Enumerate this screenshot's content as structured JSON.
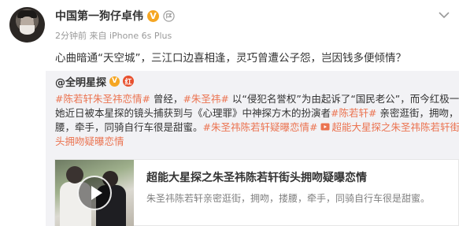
{
  "post": {
    "author": "中国第一狗仔卓伟",
    "verified_badge": "V",
    "meta": "2分钟前 来自 iPhone 6s Plus",
    "text": "心曲暗通“天空城”，三江口边喜相逢，灵巧曾遭公子怨，岂因钱多便倾情？"
  },
  "repost": {
    "author": "@全明星探",
    "verified_badge": "V",
    "hot_badge": "红",
    "line1": {
      "tag1": "#陈若轩朱圣祎恋情#",
      "t1": " 曾经，",
      "tag2": "#朱圣祎#",
      "t2": " 以“侵犯名誉权”为由起诉了“国民老公”，而今红极一时的"
    },
    "line2": {
      "t1": "她近日被本星探的镜头捕获到与《心理罪》中神探方木的扮演者",
      "tag": "#陈若轩#",
      "t2": " 亲密逛街，拥吻，搂"
    },
    "line3": {
      "t1": "腰，牵手，同骑自行车很是甜蜜。",
      "tag": "#朱圣祎陈若轩疑曝恋情#",
      "link": "超能大星探之朱圣祎陈若轩街"
    },
    "line4": {
      "link": "头拥吻疑曝恋情"
    },
    "card": {
      "title": "超能大星探之朱圣祎陈若轩街头拥吻疑曝恋情",
      "description": "朱圣祎陈若轩亲密逛街，拥吻，搂腰，牵手，同骑自行车很是甜蜜。"
    }
  },
  "colors": {
    "accent": "#eb7350",
    "verified": "#f5a623",
    "repost_bg": "#f2f2f5"
  },
  "icons": [
    "chevron-down-icon",
    "verified-icon",
    "medal-icon",
    "hot-icon",
    "link-icon",
    "play-icon"
  ]
}
